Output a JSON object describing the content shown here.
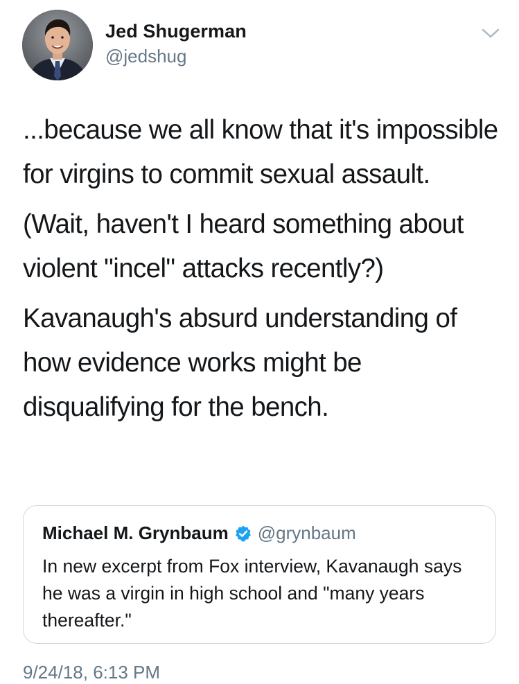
{
  "author": {
    "name": "Jed Shugerman",
    "handle": "@jedshug",
    "avatar_icon": "profile-photo"
  },
  "tweet": {
    "paragraphs": [
      "...because we all know that it's impossible for virgins to commit sexual assault.",
      "(Wait, haven't I heard something about violent \"incel\" attacks recently?)",
      "Kavanaugh's absurd understanding of how evidence works might be disqualifying for the bench."
    ],
    "timestamp": "9/24/18, 6:13 PM"
  },
  "quoted_tweet": {
    "name": "Michael M. Grynbaum",
    "handle": "@grynbaum",
    "verified": true,
    "text": "In new excerpt from Fox interview, Kavanaugh says he was a virgin in high school and \"many years thereafter.\""
  },
  "colors": {
    "text": "#14171a",
    "secondary": "#657786",
    "verified_badge": "#1da1f2",
    "border": "#cfd9de"
  },
  "icons": {
    "menu": "chevron-down-icon",
    "verified": "verified-badge-icon"
  }
}
